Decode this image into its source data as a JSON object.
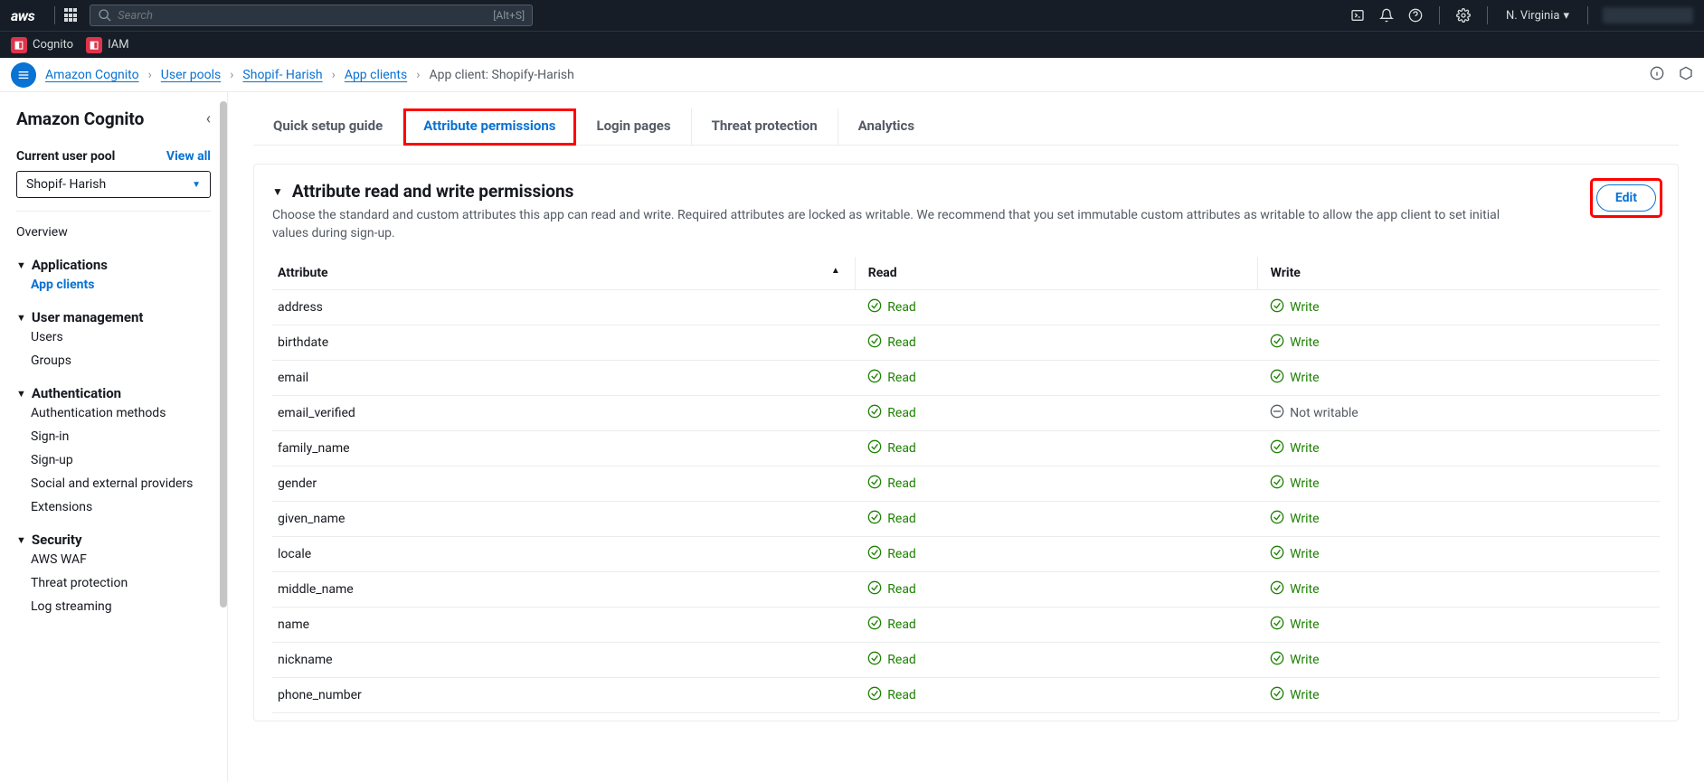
{
  "topbar": {
    "logo": "aws",
    "search_placeholder": "Search",
    "search_key": "[Alt+S]",
    "region": "N. Virginia"
  },
  "service_strip": {
    "items": [
      {
        "name": "Cognito"
      },
      {
        "name": "IAM"
      }
    ]
  },
  "breadcrumbs": {
    "items": [
      {
        "label": "Amazon Cognito",
        "link": true
      },
      {
        "label": "User pools",
        "link": true
      },
      {
        "label": "Shopif- Harish",
        "link": true
      },
      {
        "label": "App clients",
        "link": true
      },
      {
        "label": "App client: Shopify-Harish",
        "link": false
      }
    ]
  },
  "sidebar": {
    "title": "Amazon Cognito",
    "pool_label": "Current user pool",
    "view_all": "View all",
    "pool_value": "Shopif- Harish",
    "overview": "Overview",
    "groups": {
      "applications": {
        "label": "Applications",
        "items": [
          {
            "label": "App clients",
            "active": true
          }
        ]
      },
      "user_mgmt": {
        "label": "User management",
        "items": [
          {
            "label": "Users"
          },
          {
            "label": "Groups"
          }
        ]
      },
      "auth": {
        "label": "Authentication",
        "items": [
          {
            "label": "Authentication methods"
          },
          {
            "label": "Sign-in"
          },
          {
            "label": "Sign-up"
          },
          {
            "label": "Social and external providers"
          },
          {
            "label": "Extensions"
          }
        ]
      },
      "security": {
        "label": "Security",
        "items": [
          {
            "label": "AWS WAF"
          },
          {
            "label": "Threat protection"
          },
          {
            "label": "Log streaming"
          }
        ]
      }
    }
  },
  "tabs": [
    {
      "label": "Quick setup guide"
    },
    {
      "label": "Attribute permissions",
      "active": true
    },
    {
      "label": "Login pages"
    },
    {
      "label": "Threat protection"
    },
    {
      "label": "Analytics"
    }
  ],
  "panel": {
    "title": "Attribute read and write permissions",
    "desc": "Choose the standard and custom attributes this app can read and write. Required attributes are locked as writable. We recommend that you set immutable custom attributes as writable to allow the app client to set initial values during sign-up.",
    "edit_label": "Edit",
    "columns": {
      "attr": "Attribute",
      "read": "Read",
      "write": "Write"
    },
    "read_label": "Read",
    "write_label": "Write",
    "not_writable_label": "Not writable",
    "rows": [
      {
        "attr": "address",
        "read": true,
        "write": true
      },
      {
        "attr": "birthdate",
        "read": true,
        "write": true
      },
      {
        "attr": "email",
        "read": true,
        "write": true
      },
      {
        "attr": "email_verified",
        "read": true,
        "write": false
      },
      {
        "attr": "family_name",
        "read": true,
        "write": true
      },
      {
        "attr": "gender",
        "read": true,
        "write": true
      },
      {
        "attr": "given_name",
        "read": true,
        "write": true
      },
      {
        "attr": "locale",
        "read": true,
        "write": true
      },
      {
        "attr": "middle_name",
        "read": true,
        "write": true
      },
      {
        "attr": "name",
        "read": true,
        "write": true
      },
      {
        "attr": "nickname",
        "read": true,
        "write": true
      },
      {
        "attr": "phone_number",
        "read": true,
        "write": true
      }
    ]
  }
}
